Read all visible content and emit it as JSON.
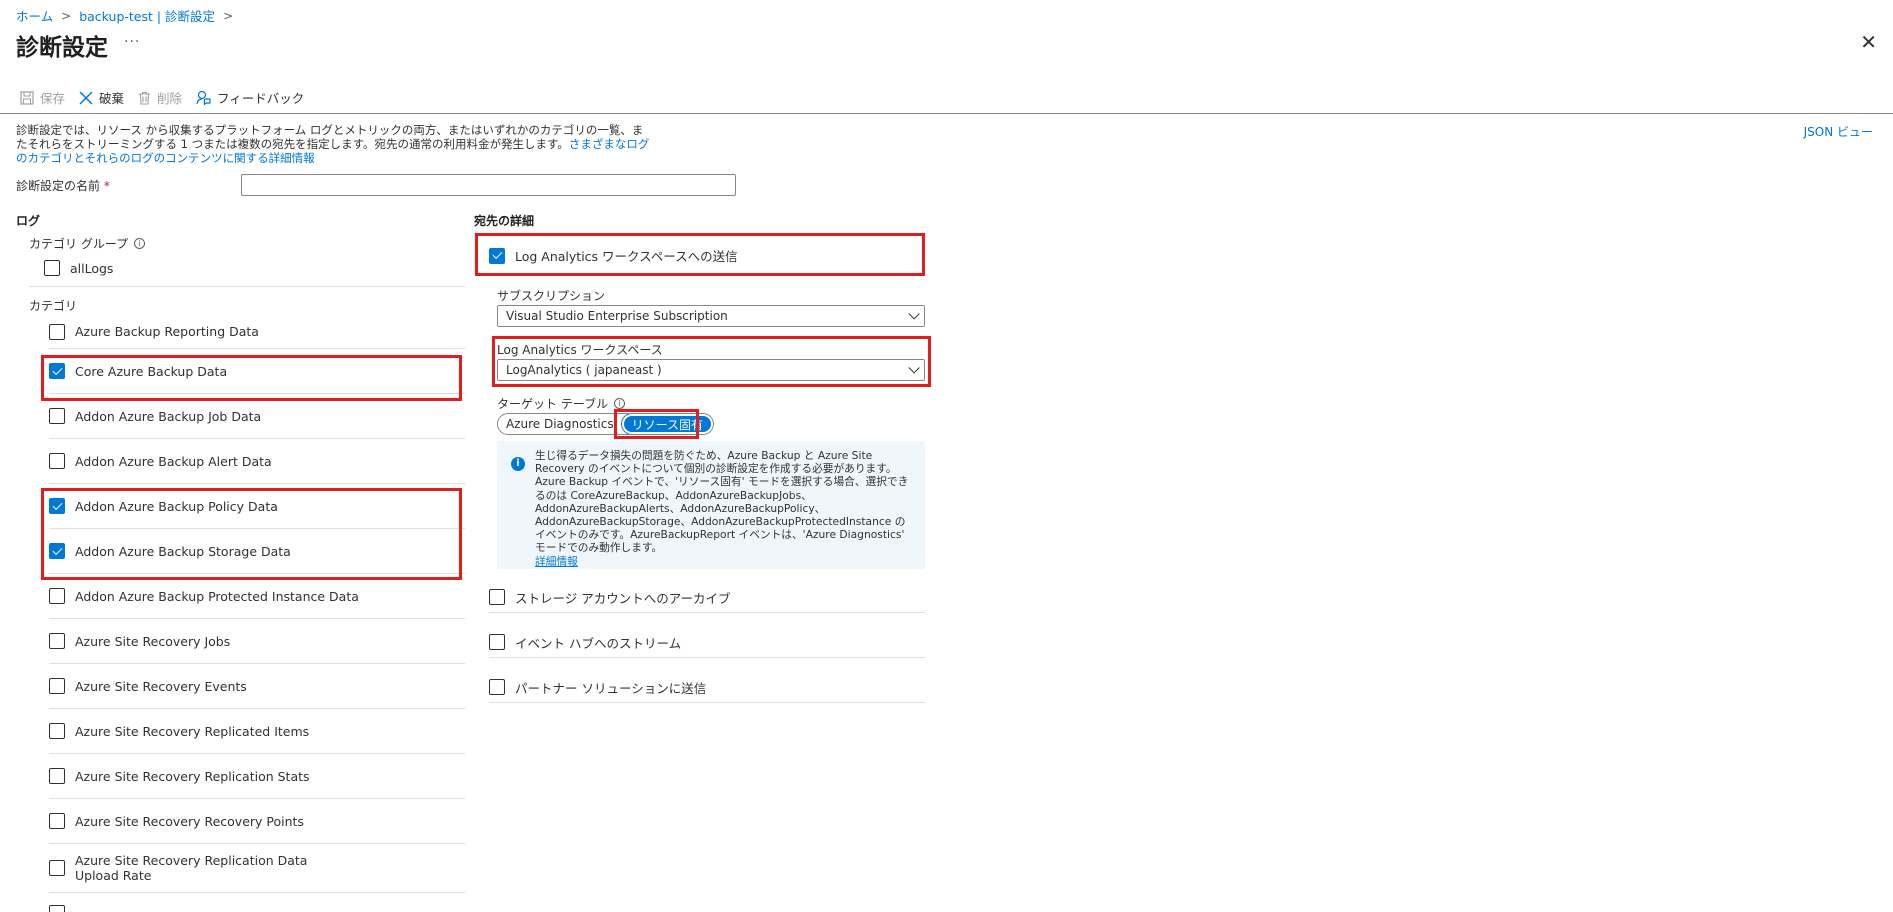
{
  "breadcrumb": [
    "ホーム",
    "backup-test | 診断設定"
  ],
  "page": {
    "title": "診断設定",
    "more": "···",
    "close": "✕"
  },
  "toolbar": {
    "save": "保存",
    "discard": "破棄",
    "delete": "削除",
    "feedback": "フィードバック"
  },
  "description": {
    "text": "診断設定では、リソース から収集するプラットフォーム ログとメトリックの両方、またはいずれかのカテゴリの一覧、またそれらをストリーミングする 1 つまたは複数の宛先を指定します。宛先の通常の利用料金が発生します。",
    "link": "さまざまなログのカテゴリとそれらのログのコンテンツに関する詳細情報"
  },
  "json_view": "JSON ビュー",
  "name_field": {
    "label": "診断設定の名前",
    "required": "*",
    "value": ""
  },
  "logs": {
    "header": "ログ",
    "category_group": {
      "label": "カテゴリ グループ",
      "items": [
        {
          "label": "allLogs",
          "checked": false
        }
      ]
    },
    "category_label": "カテゴリ",
    "categories": [
      {
        "label": "Azure Backup Reporting Data",
        "checked": false
      },
      {
        "label": "Core Azure Backup Data",
        "checked": true
      },
      {
        "label": "Addon Azure Backup Job Data",
        "checked": false
      },
      {
        "label": "Addon Azure Backup Alert Data",
        "checked": false
      },
      {
        "label": "Addon Azure Backup Policy Data",
        "checked": true
      },
      {
        "label": "Addon Azure Backup Storage Data",
        "checked": true
      },
      {
        "label": "Addon Azure Backup Protected Instance Data",
        "checked": false
      },
      {
        "label": "Azure Site Recovery Jobs",
        "checked": false
      },
      {
        "label": "Azure Site Recovery Events",
        "checked": false
      },
      {
        "label": "Azure Site Recovery Replicated Items",
        "checked": false
      },
      {
        "label": "Azure Site Recovery Replication Stats",
        "checked": false
      },
      {
        "label": "Azure Site Recovery Recovery Points",
        "checked": false
      },
      {
        "label": "Azure Site Recovery Replication Data Upload Rate",
        "checked": false
      }
    ]
  },
  "destination": {
    "header": "宛先の詳細",
    "log_analytics": {
      "label": "Log Analytics ワークスペースへの送信",
      "checked": true
    },
    "subscription": {
      "label": "サブスクリプション",
      "value": "Visual Studio Enterprise Subscription"
    },
    "workspace": {
      "label": "Log Analytics ワークスペース",
      "value": "LogAnalytics ( japaneast )"
    },
    "target_table": {
      "label": "ターゲット テーブル",
      "options": [
        "Azure Diagnostics",
        "リソース固有"
      ],
      "selected": "リソース固有"
    },
    "info": {
      "text": "生じ得るデータ損失の問題を防ぐため、Azure Backup と Azure Site Recovery のイベントについて個別の診断設定を作成する必要があります。Azure Backup イベントで、'リソース固有' モードを選択する場合、選択できるのは CoreAzureBackup、AddonAzureBackupJobs、AddonAzureBackupAlerts、AddonAzureBackupPolicy、AddonAzureBackupStorage、AddonAzureBackupProtectedInstance のイベントのみです。AzureBackupReport イベントは、'Azure Diagnostics' モードでのみ動作します。",
      "link": "詳細情報"
    },
    "storage": {
      "label": "ストレージ アカウントへのアーカイブ",
      "checked": false
    },
    "event_hub": {
      "label": "イベント ハブへのストリーム",
      "checked": false
    },
    "partner": {
      "label": "パートナー ソリューションに送信",
      "checked": false
    }
  },
  "colors": {
    "accent": "#0078d4",
    "highlight": "#e01e1e"
  }
}
